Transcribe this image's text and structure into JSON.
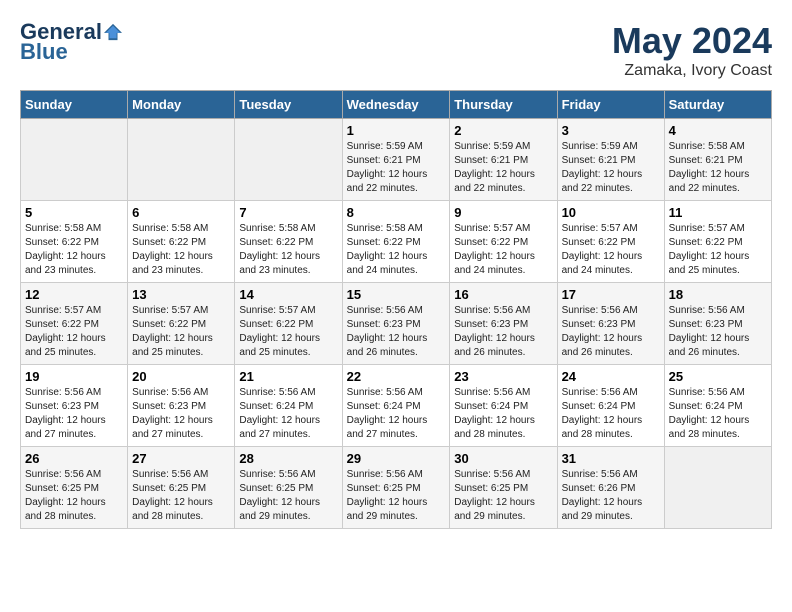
{
  "header": {
    "logo_line1": "General",
    "logo_line2": "Blue",
    "main_title": "May 2024",
    "subtitle": "Zamaka, Ivory Coast"
  },
  "days_of_week": [
    "Sunday",
    "Monday",
    "Tuesday",
    "Wednesday",
    "Thursday",
    "Friday",
    "Saturday"
  ],
  "weeks": [
    [
      {
        "day": "",
        "info": ""
      },
      {
        "day": "",
        "info": ""
      },
      {
        "day": "",
        "info": ""
      },
      {
        "day": "1",
        "info": "Sunrise: 5:59 AM\nSunset: 6:21 PM\nDaylight: 12 hours\nand 22 minutes."
      },
      {
        "day": "2",
        "info": "Sunrise: 5:59 AM\nSunset: 6:21 PM\nDaylight: 12 hours\nand 22 minutes."
      },
      {
        "day": "3",
        "info": "Sunrise: 5:59 AM\nSunset: 6:21 PM\nDaylight: 12 hours\nand 22 minutes."
      },
      {
        "day": "4",
        "info": "Sunrise: 5:58 AM\nSunset: 6:21 PM\nDaylight: 12 hours\nand 22 minutes."
      }
    ],
    [
      {
        "day": "5",
        "info": "Sunrise: 5:58 AM\nSunset: 6:22 PM\nDaylight: 12 hours\nand 23 minutes."
      },
      {
        "day": "6",
        "info": "Sunrise: 5:58 AM\nSunset: 6:22 PM\nDaylight: 12 hours\nand 23 minutes."
      },
      {
        "day": "7",
        "info": "Sunrise: 5:58 AM\nSunset: 6:22 PM\nDaylight: 12 hours\nand 23 minutes."
      },
      {
        "day": "8",
        "info": "Sunrise: 5:58 AM\nSunset: 6:22 PM\nDaylight: 12 hours\nand 24 minutes."
      },
      {
        "day": "9",
        "info": "Sunrise: 5:57 AM\nSunset: 6:22 PM\nDaylight: 12 hours\nand 24 minutes."
      },
      {
        "day": "10",
        "info": "Sunrise: 5:57 AM\nSunset: 6:22 PM\nDaylight: 12 hours\nand 24 minutes."
      },
      {
        "day": "11",
        "info": "Sunrise: 5:57 AM\nSunset: 6:22 PM\nDaylight: 12 hours\nand 25 minutes."
      }
    ],
    [
      {
        "day": "12",
        "info": "Sunrise: 5:57 AM\nSunset: 6:22 PM\nDaylight: 12 hours\nand 25 minutes."
      },
      {
        "day": "13",
        "info": "Sunrise: 5:57 AM\nSunset: 6:22 PM\nDaylight: 12 hours\nand 25 minutes."
      },
      {
        "day": "14",
        "info": "Sunrise: 5:57 AM\nSunset: 6:22 PM\nDaylight: 12 hours\nand 25 minutes."
      },
      {
        "day": "15",
        "info": "Sunrise: 5:56 AM\nSunset: 6:23 PM\nDaylight: 12 hours\nand 26 minutes."
      },
      {
        "day": "16",
        "info": "Sunrise: 5:56 AM\nSunset: 6:23 PM\nDaylight: 12 hours\nand 26 minutes."
      },
      {
        "day": "17",
        "info": "Sunrise: 5:56 AM\nSunset: 6:23 PM\nDaylight: 12 hours\nand 26 minutes."
      },
      {
        "day": "18",
        "info": "Sunrise: 5:56 AM\nSunset: 6:23 PM\nDaylight: 12 hours\nand 26 minutes."
      }
    ],
    [
      {
        "day": "19",
        "info": "Sunrise: 5:56 AM\nSunset: 6:23 PM\nDaylight: 12 hours\nand 27 minutes."
      },
      {
        "day": "20",
        "info": "Sunrise: 5:56 AM\nSunset: 6:23 PM\nDaylight: 12 hours\nand 27 minutes."
      },
      {
        "day": "21",
        "info": "Sunrise: 5:56 AM\nSunset: 6:24 PM\nDaylight: 12 hours\nand 27 minutes."
      },
      {
        "day": "22",
        "info": "Sunrise: 5:56 AM\nSunset: 6:24 PM\nDaylight: 12 hours\nand 27 minutes."
      },
      {
        "day": "23",
        "info": "Sunrise: 5:56 AM\nSunset: 6:24 PM\nDaylight: 12 hours\nand 28 minutes."
      },
      {
        "day": "24",
        "info": "Sunrise: 5:56 AM\nSunset: 6:24 PM\nDaylight: 12 hours\nand 28 minutes."
      },
      {
        "day": "25",
        "info": "Sunrise: 5:56 AM\nSunset: 6:24 PM\nDaylight: 12 hours\nand 28 minutes."
      }
    ],
    [
      {
        "day": "26",
        "info": "Sunrise: 5:56 AM\nSunset: 6:25 PM\nDaylight: 12 hours\nand 28 minutes."
      },
      {
        "day": "27",
        "info": "Sunrise: 5:56 AM\nSunset: 6:25 PM\nDaylight: 12 hours\nand 28 minutes."
      },
      {
        "day": "28",
        "info": "Sunrise: 5:56 AM\nSunset: 6:25 PM\nDaylight: 12 hours\nand 29 minutes."
      },
      {
        "day": "29",
        "info": "Sunrise: 5:56 AM\nSunset: 6:25 PM\nDaylight: 12 hours\nand 29 minutes."
      },
      {
        "day": "30",
        "info": "Sunrise: 5:56 AM\nSunset: 6:25 PM\nDaylight: 12 hours\nand 29 minutes."
      },
      {
        "day": "31",
        "info": "Sunrise: 5:56 AM\nSunset: 6:26 PM\nDaylight: 12 hours\nand 29 minutes."
      },
      {
        "day": "",
        "info": ""
      }
    ]
  ]
}
